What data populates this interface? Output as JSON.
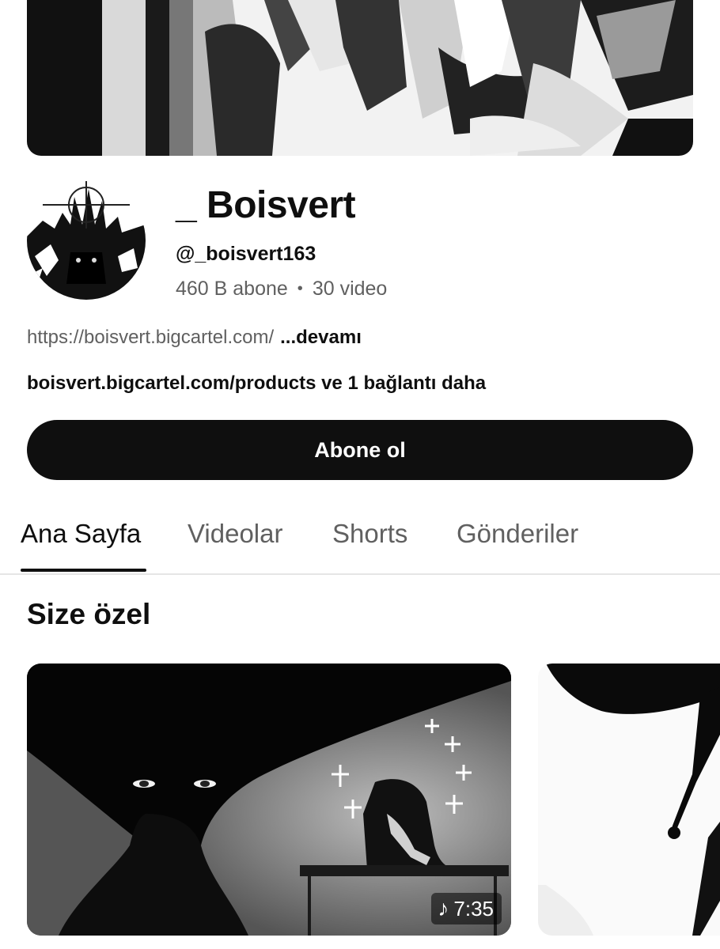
{
  "channel": {
    "name": "_ Boisvert",
    "handle": "@_boisvert163",
    "subscribers": "460 B abone",
    "videos": "30 video",
    "stats_separator": "•",
    "description": "https://boisvert.bigcartel.com/",
    "more_label": "...devamı",
    "links": "boisvert.bigcartel.com/products ve 1 bağlantı daha"
  },
  "subscribe": {
    "label": "Abone ol"
  },
  "tabs": [
    {
      "label": "Ana Sayfa",
      "active": true
    },
    {
      "label": "Videolar",
      "active": false
    },
    {
      "label": "Shorts",
      "active": false
    },
    {
      "label": "Gönderiler",
      "active": false
    }
  ],
  "section": {
    "title": "Size özel"
  },
  "videos": [
    {
      "duration": "7:35",
      "icon": "music-note-icon"
    },
    {
      "duration": "",
      "icon": ""
    }
  ],
  "icons": {
    "music_note": "♪"
  },
  "colors": {
    "subscribe_bg": "#0f0f0f",
    "secondary_text": "#606060",
    "tab_divider": "#e5e5e5"
  }
}
